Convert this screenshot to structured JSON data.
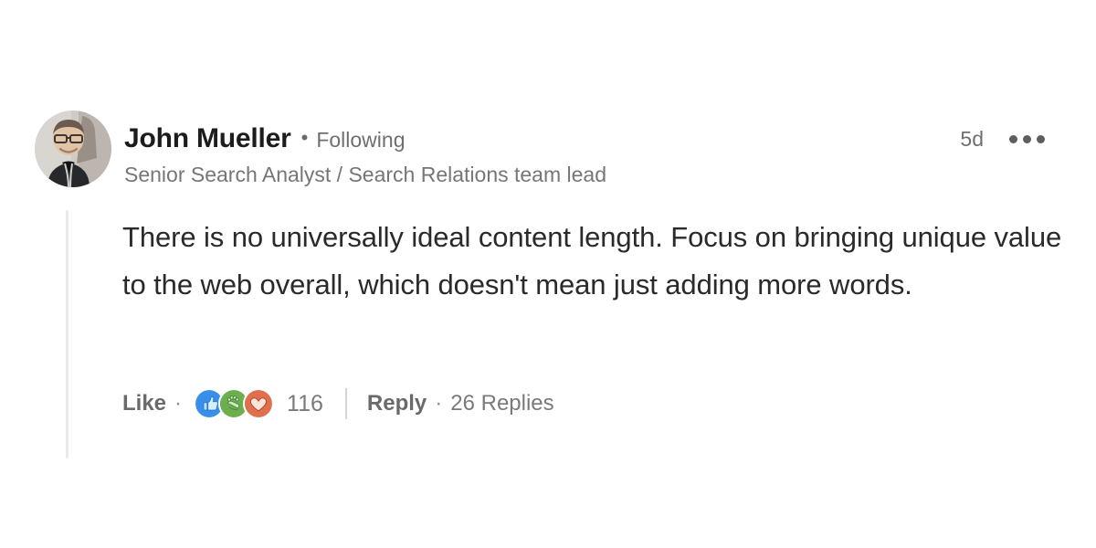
{
  "comment": {
    "author": {
      "name": "John Mueller",
      "separator": "•",
      "follow_status": "Following",
      "headline": "Senior Search Analyst / Search Relations team lead",
      "avatar_alt": "John Mueller profile photo"
    },
    "meta": {
      "timestamp": "5d",
      "more_menu_label": "•••"
    },
    "text": "There is no universally ideal content length. Focus on bringing unique value to the web overall, which doesn't mean just adding more words.",
    "actions": {
      "like_label": "Like",
      "dot_separator": "·",
      "reaction_count": "116",
      "reply_label": "Reply",
      "replies_label": "26 Replies",
      "reactions": [
        {
          "name": "like-reaction-icon",
          "label": "Like",
          "color": "#378fe9"
        },
        {
          "name": "celebrate-reaction-icon",
          "label": "Celebrate",
          "color": "#6dae4f"
        },
        {
          "name": "love-reaction-icon",
          "label": "Love",
          "color": "#df704d"
        }
      ]
    }
  },
  "colors": {
    "page_background": "#ffffff",
    "name_text": "#1c1c1c",
    "body_text": "#2a2a2a",
    "muted_text": "#6f6f6f",
    "thread_line": "#eceae6",
    "divider": "#d4d4d4",
    "reaction_like_blue": "#378fe9",
    "reaction_celebrate_green": "#6dae4f",
    "reaction_love_red": "#df704d"
  }
}
